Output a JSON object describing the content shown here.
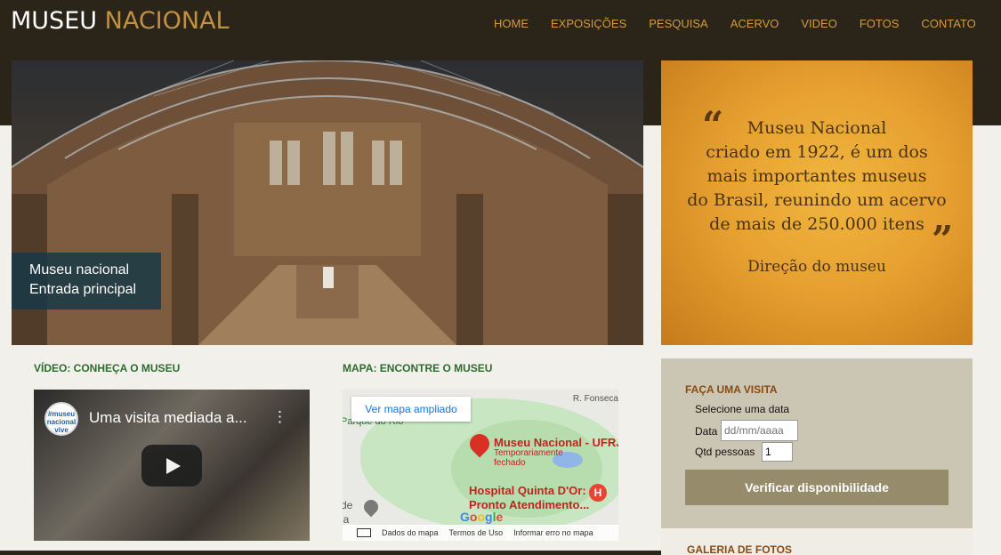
{
  "header": {
    "logo_part1": "MUSEU",
    "logo_part2": "NACIONAL",
    "nav": [
      "HOME",
      "EXPOSIÇÕES",
      "PESQUISA",
      "ACERVO",
      "VIDEO",
      "FOTOS",
      "CONTATO"
    ]
  },
  "hero": {
    "caption_line1": "Museu nacional",
    "caption_line2": "Entrada principal"
  },
  "quote": {
    "lines": [
      "Museu Nacional",
      "criado em 1922, é um dos",
      "mais importantes museus",
      "do Brasil, reunindo um acervo",
      "de mais de 250.000 itens"
    ],
    "author": "Direção do museu",
    "open_mark": "“",
    "close_mark": "”"
  },
  "video_section": {
    "title": "VÍDEO: CONHEÇA O MUSEU",
    "video_title": "Uma visita mediada a...",
    "channel_label": "#museu nacional vive",
    "more_icon": "more-vert-icon",
    "play_icon": "play-icon"
  },
  "map_section": {
    "title": "MAPA: ENCONTRE O MUSEU",
    "link": "Ver mapa ampliado",
    "street": "R. Fonseca",
    "park": "Parque do Rio",
    "place_name": "Museu Nacional - UFRJ",
    "place_status_1": "Temporariamente",
    "place_status_2": "fechado",
    "hospital_1": "Hospital Quinta D'Or:",
    "hospital_2": "Pronto Atendimento...",
    "left_text_1": "de",
    "left_text_2": "ia",
    "google": [
      "G",
      "o",
      "o",
      "g",
      "l",
      "e"
    ],
    "footer": [
      "Dados do mapa",
      "Termos de Uso",
      "Informar erro no mapa"
    ]
  },
  "visit": {
    "title": "FAÇA UMA VISITA",
    "select_date": "Selecione uma data",
    "date_label": "Data",
    "date_placeholder": "dd/mm/aaaa",
    "people_label": "Qtd pessoas",
    "people_value": "1",
    "button": "Verificar disponibilidade"
  },
  "gallery": {
    "title": "GALERIA DE FOTOS"
  },
  "colors": {
    "topbar": "#2a2419",
    "accent": "#d49a3d",
    "section_title": "#2e6b2e",
    "visit_title": "#8a4a10",
    "button": "#968c6c"
  }
}
